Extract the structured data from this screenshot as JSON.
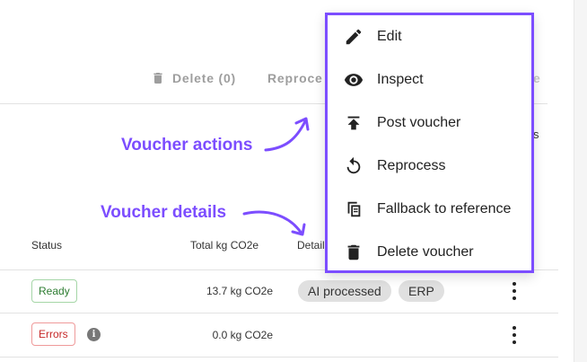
{
  "toolbar": {
    "delete_label": "Delete (0)",
    "reprocess_label": "Reprocess",
    "trailing_label": "e"
  },
  "table": {
    "columns": [
      "Status",
      "Total kg CO2e",
      "Details"
    ],
    "trailing_header": "s",
    "rows": [
      {
        "status": "Ready",
        "total": "13.7 kg CO2e",
        "details": [
          "AI processed",
          "ERP"
        ]
      },
      {
        "status": "Errors",
        "info_icon": "info-icon",
        "total": "0.0 kg CO2e",
        "details": []
      }
    ]
  },
  "annotations": {
    "actions": "Voucher actions",
    "details": "Voucher details",
    "color": "#7c4dff"
  },
  "menu": {
    "items": [
      {
        "label": "Edit",
        "icon": "pencil-icon"
      },
      {
        "label": "Inspect",
        "icon": "eye-icon"
      },
      {
        "label": "Post voucher",
        "icon": "upload-icon"
      },
      {
        "label": "Reprocess",
        "icon": "refresh-icon"
      },
      {
        "label": "Fallback to reference",
        "icon": "fallback-reference-icon"
      },
      {
        "label": "Delete voucher",
        "icon": "trash-icon"
      }
    ]
  },
  "colors": {
    "accent": "#7c4dff",
    "ready": "#2e7d32",
    "errors": "#c62828",
    "chip_bg": "#e0e0e0"
  }
}
